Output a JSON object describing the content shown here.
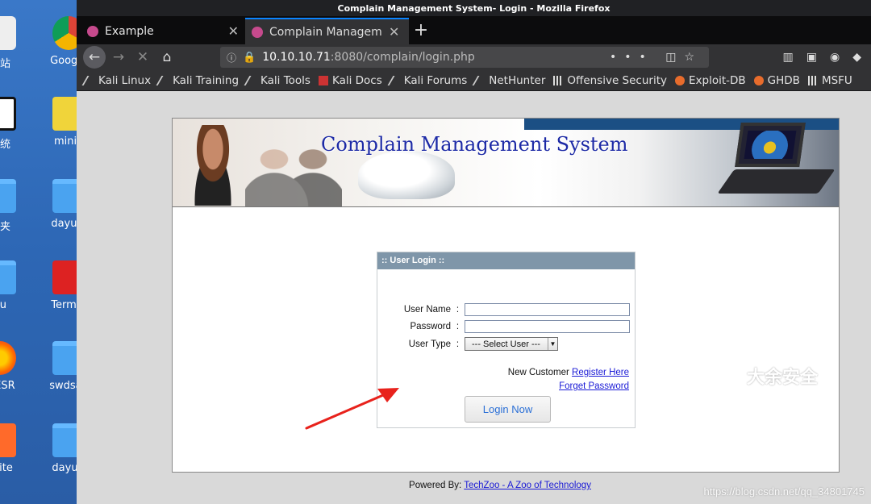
{
  "desktop": {
    "icons": [
      {
        "label": "收站"
      },
      {
        "label": "Google"
      },
      {
        "label": "系统"
      },
      {
        "label": "minio"
      },
      {
        "label": "件夹"
      },
      {
        "label": "dayuM"
      },
      {
        "label": "yu"
      },
      {
        "label": "Termin"
      },
      {
        "label": "x ESR"
      },
      {
        "label": "swdsac"
      },
      {
        "label": "suite"
      },
      {
        "label": "dayuR"
      }
    ]
  },
  "window": {
    "title": "Complain Management System- Login - Mozilla Firefox"
  },
  "tabs": [
    {
      "label": "Example"
    },
    {
      "label": "Complain Management Sy"
    }
  ],
  "urlbar": {
    "host": "10.10.10.71",
    "rest": ":8080/complain/login.php"
  },
  "bookmarks": [
    {
      "label": "Kali Linux",
      "icon": "kali-icon"
    },
    {
      "label": "Kali Training",
      "icon": "kali-icon"
    },
    {
      "label": "Kali Tools",
      "icon": "kali-icon"
    },
    {
      "label": "Kali Docs",
      "icon": "kali-docs-icon"
    },
    {
      "label": "Kali Forums",
      "icon": "kali-icon"
    },
    {
      "label": "NetHunter",
      "icon": "kali-icon"
    },
    {
      "label": "Offensive Security",
      "icon": "offsec-icon"
    },
    {
      "label": "Exploit-DB",
      "icon": "exploitdb-icon"
    },
    {
      "label": "GHDB",
      "icon": "ghdb-icon"
    },
    {
      "label": "MSFU",
      "icon": "msfu-icon"
    }
  ],
  "site": {
    "title": "Complain Management System"
  },
  "login": {
    "header": ":: User Login ::",
    "username_label": "User Name",
    "password_label": "Password",
    "usertype_label": "User Type",
    "colon": ":",
    "usertype_selected": "--- Select User ---",
    "new_customer": "New Customer",
    "register_link": "Register Here",
    "forget_link": "Forget Password",
    "login_button": "Login Now"
  },
  "footer": {
    "powered_by": "Powered By:",
    "link": "TechZoo - A Zoo of Technology"
  },
  "watermark": {
    "text": "大余安全",
    "url": "https://blog.csdn.net/qq_34801745"
  },
  "colors": {
    "accent_tab": "#0a84ff",
    "login_header": "#7f96a9",
    "site_title": "#1d2aa6",
    "arrow": "#e8221c"
  }
}
